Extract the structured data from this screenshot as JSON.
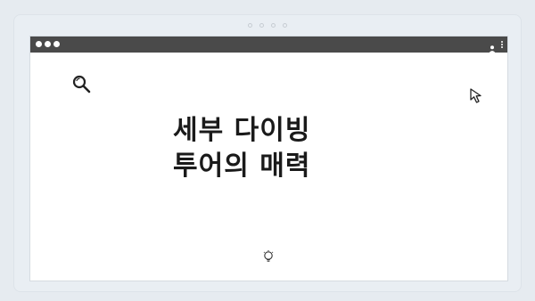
{
  "headline": {
    "line1": "세부 다이빙",
    "line2": "투어의 매력"
  },
  "icons": {
    "search": "search-icon",
    "cursor": "cursor-arrow-icon",
    "bulb": "lightbulb-icon",
    "user": "user-icon",
    "menu": "kebab-menu-icon"
  },
  "colors": {
    "page_background": "#e6ebf0",
    "title_bar": "#4a4a4a",
    "window_background": "#ffffff",
    "headline_text": "#1a1a1a"
  },
  "pager": {
    "count": 4
  }
}
